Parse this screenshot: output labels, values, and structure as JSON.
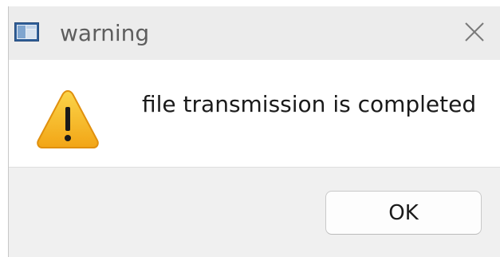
{
  "window": {
    "title": "warning",
    "app_icon": "window-app-icon",
    "close_icon": "close-icon"
  },
  "dialog": {
    "icon": "warning-triangle-icon",
    "message": "file transmission is completed",
    "ok_label": "OK"
  },
  "colors": {
    "titlebar_bg": "#ececec",
    "footer_bg": "#f0f0f0",
    "warning_yellow": "#f7c12a",
    "warning_orange": "#e8920c"
  }
}
